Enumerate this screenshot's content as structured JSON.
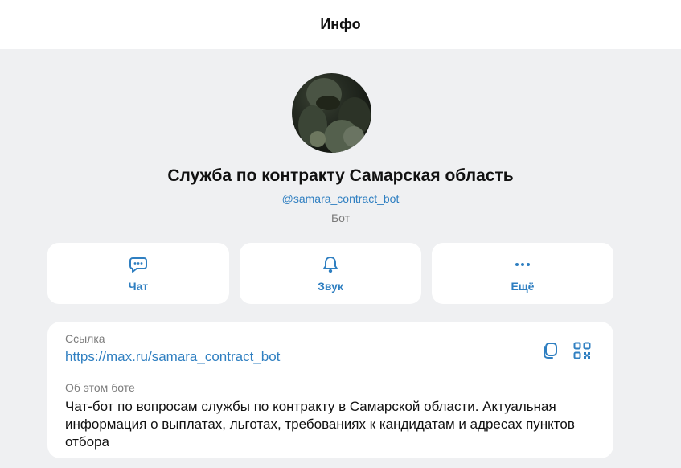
{
  "header": {
    "title": "Инфо"
  },
  "profile": {
    "name": "Служба по контракту Самарская область",
    "username": "@samara_contract_bot",
    "kind": "Бот"
  },
  "actions": [
    {
      "label": "Чат",
      "icon": "chat-icon"
    },
    {
      "label": "Звук",
      "icon": "bell-icon"
    },
    {
      "label": "Ещё",
      "icon": "more-icon"
    }
  ],
  "info": {
    "link_label": "Ссылка",
    "link": "https://max.ru/samara_contract_bot",
    "about_label": "Об этом боте",
    "about": "Чат-бот по вопросам службы по контракту в Самарской области. Актуальная информация о выплатах, льготах, требованиях к кандидатам и адресах пунктов отбора"
  },
  "colors": {
    "accent": "#2f7fc1",
    "background": "#eff0f2",
    "card": "#ffffff"
  }
}
